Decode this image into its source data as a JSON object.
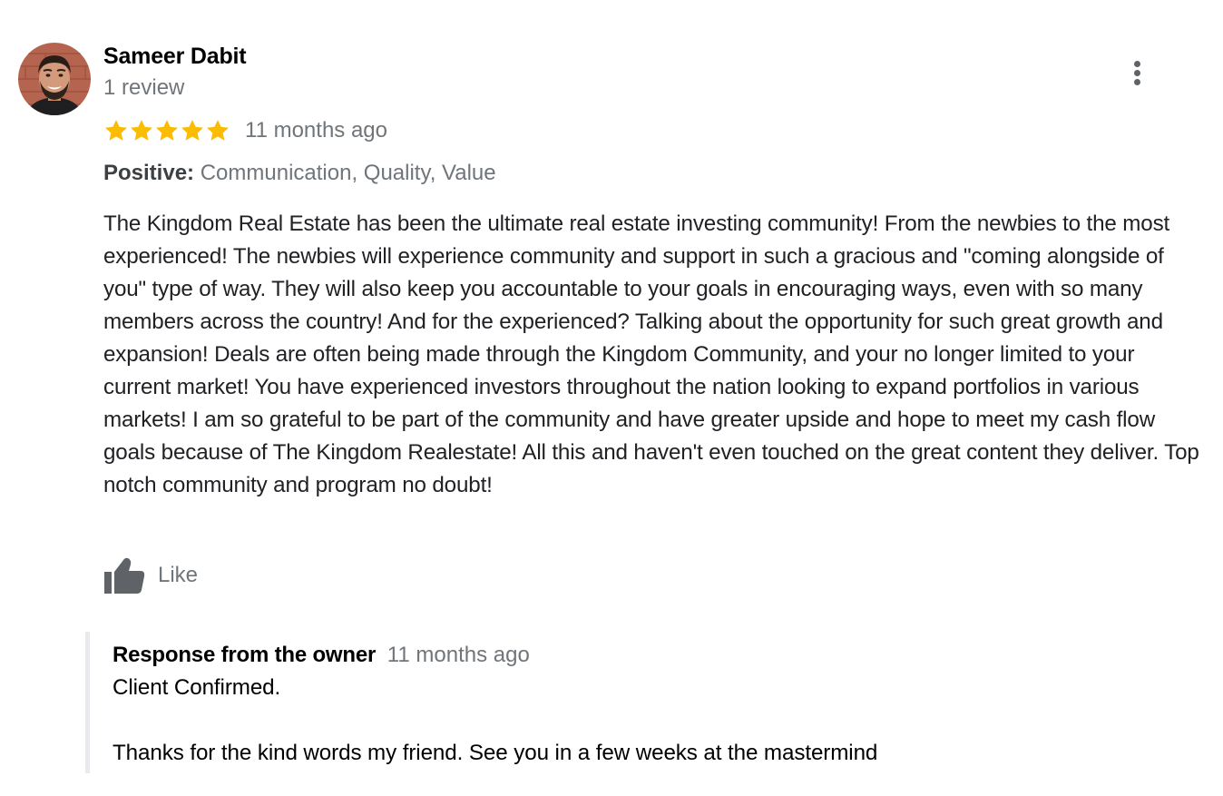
{
  "reviewer": {
    "name": "Sameer Dabit",
    "review_count": "1 review",
    "avatar_icon": "profile-photo"
  },
  "menu": {
    "icon": "more-vert-icon"
  },
  "rating": {
    "stars": 5,
    "max_stars": 5,
    "star_color": "#fbbc04",
    "date": "11 months ago"
  },
  "highlights": {
    "label": "Positive:",
    "value": "Communication, Quality, Value"
  },
  "review_text": "The Kingdom Real Estate has been the ultimate real estate investing community! From the newbies to the most experienced! The newbies will experience community and support in such a gracious and \"coming alongside of you\" type of way. They will also keep you accountable to your goals in encouraging ways, even with so many members across the country! And for the experienced? Talking about the opportunity for such great growth and expansion! Deals are often being made through the Kingdom Community, and your no longer limited to your current market! You have experienced investors throughout the nation looking to expand portfolios in various markets! I am so grateful to be part of the community and have greater upside and hope to meet my cash flow goals because of The Kingdom Realestate! All this and haven't even touched on the great content they deliver. Top notch community and program no doubt!",
  "like": {
    "label": "Like",
    "icon": "thumb-up-icon"
  },
  "owner_response": {
    "title": "Response from the owner",
    "date": "11 months ago",
    "lines": [
      "Client Confirmed.",
      "",
      "Thanks for the kind words my friend. See you in a few weeks at the mastermind"
    ]
  },
  "colors": {
    "secondary_text": "#70757a",
    "primary_text": "#202124",
    "icon_gray": "#5f6368",
    "response_border": "#e8eaed"
  }
}
